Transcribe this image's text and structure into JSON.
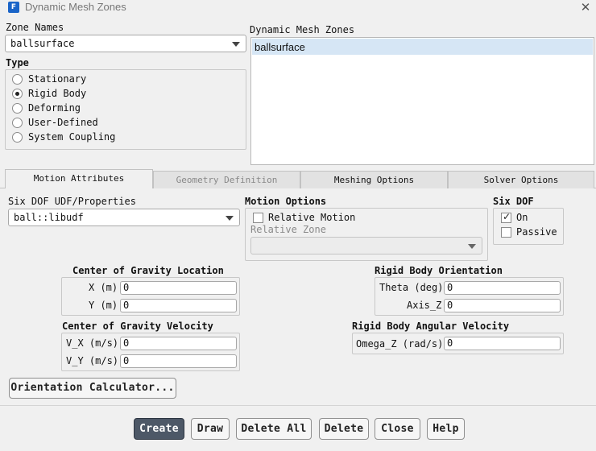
{
  "window": {
    "title": "Dynamic Mesh Zones",
    "app_icon": "F",
    "close_glyph": "✕"
  },
  "zone_names": {
    "label": "Zone Names",
    "selected": "ballsurface"
  },
  "dynamic_mesh_zones": {
    "label": "Dynamic Mesh Zones",
    "items": [
      "ballsurface"
    ]
  },
  "type": {
    "label": "Type",
    "options": [
      "Stationary",
      "Rigid Body",
      "Deforming",
      "User-Defined",
      "System Coupling"
    ],
    "selected": "Rigid Body"
  },
  "tabs": {
    "items": [
      "Motion Attributes",
      "Geometry Definition",
      "Meshing Options",
      "Solver Options"
    ],
    "active": "Motion Attributes"
  },
  "six_dof_udf": {
    "label": "Six DOF UDF/Properties",
    "selected": "ball::libudf"
  },
  "motion_options": {
    "label": "Motion Options",
    "relative_motion_label": "Relative Motion",
    "relative_motion_checked": false,
    "relative_zone_label": "Relative Zone",
    "relative_zone_value": ""
  },
  "six_dof": {
    "label": "Six DOF",
    "on_label": "On",
    "on_checked": true,
    "passive_label": "Passive",
    "passive_checked": false,
    "check_glyph": "✓"
  },
  "cg_location": {
    "label": "Center of Gravity Location",
    "x_label": "X (m)",
    "x_value": "0",
    "y_label": "Y (m)",
    "y_value": "0"
  },
  "rb_orientation": {
    "label": "Rigid Body Orientation",
    "theta_label": "Theta (deg)",
    "theta_value": "0",
    "axis_label": "Axis_Z",
    "axis_value": "0"
  },
  "cg_velocity": {
    "label": "Center of Gravity Velocity",
    "vx_label": "V_X (m/s)",
    "vx_value": "0",
    "vy_label": "V_Y (m/s)",
    "vy_value": "0"
  },
  "rb_angular_velocity": {
    "label": "Rigid Body Angular Velocity",
    "omega_label": "Omega_Z (rad/s)",
    "omega_value": "0"
  },
  "buttons": {
    "orientation_calculator": "Orientation Calculator...",
    "create": "Create",
    "draw": "Draw",
    "delete_all": "Delete All",
    "delete": "Delete",
    "close": "Close",
    "help": "Help"
  },
  "colors": {
    "primary_button": "#4d5867",
    "selection": "#d6e6f5",
    "app_icon": "#1a64c8"
  }
}
